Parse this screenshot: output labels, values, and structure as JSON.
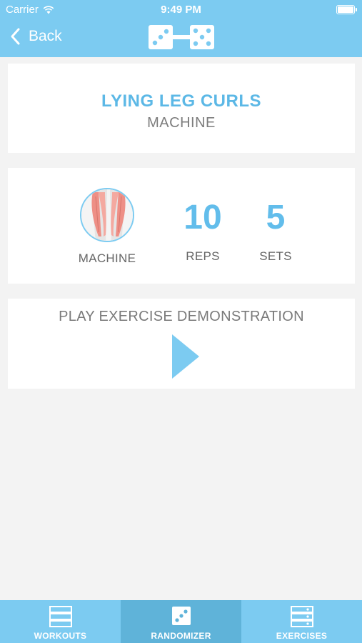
{
  "status_bar": {
    "carrier": "Carrier",
    "time": "9:49 PM"
  },
  "nav": {
    "back_label": "Back",
    "logo_icon": "dice-dumbbell-icon"
  },
  "exercise": {
    "name": "LYING LEG CURLS",
    "equipment": "MACHINE"
  },
  "stats": {
    "equipment_label": "MACHINE",
    "reps_value": "10",
    "reps_label": "REPS",
    "sets_value": "5",
    "sets_label": "SETS",
    "muscle_icon": "hamstrings-muscle-icon"
  },
  "demo": {
    "label": "PLAY EXERCISE DEMONSTRATION",
    "icon": "play-icon"
  },
  "tabs": [
    {
      "label": "WORKOUTS",
      "icon": "list-icon",
      "active": false
    },
    {
      "label": "RANDOMIZER",
      "icon": "dice-icon",
      "active": true
    },
    {
      "label": "EXERCISES",
      "icon": "exercises-list-icon",
      "active": false
    }
  ],
  "colors": {
    "accent": "#7ccbf1",
    "accent_dark": "#5fb3d9",
    "title_blue": "#5cb8e6"
  }
}
